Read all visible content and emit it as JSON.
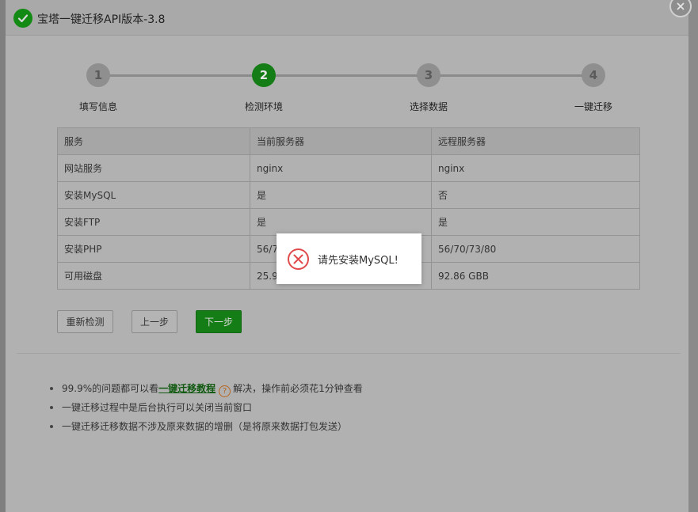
{
  "modal": {
    "title": "宝塔一键迁移API版本-3.8"
  },
  "steps": [
    {
      "number": "1",
      "label": "填写信息"
    },
    {
      "number": "2",
      "label": "检测环境"
    },
    {
      "number": "3",
      "label": "选择数据"
    },
    {
      "number": "4",
      "label": "一键迁移"
    }
  ],
  "table": {
    "headers": [
      "服务",
      "当前服务器",
      "远程服务器"
    ],
    "rows": [
      [
        "网站服务",
        "nginx",
        "nginx"
      ],
      [
        "安装MySQL",
        "是",
        "否"
      ],
      [
        "安装FTP",
        "是",
        "是"
      ],
      [
        "安装PHP",
        "56/7",
        "56/70/73/80"
      ],
      [
        "可用磁盘",
        "25.9",
        "92.86 GBB"
      ]
    ]
  },
  "buttons": {
    "recheck": "重新检测",
    "prev": "上一步",
    "next": "下一步"
  },
  "notes": {
    "line1_prefix": "99.9%的问题都可以看",
    "line1_link": "一键迁移教程",
    "line1_suffix": "解决，操作前必须花1分钟查看",
    "line2": "一键迁移过程中是后台执行可以关闭当前窗口",
    "line3": "一键迁移迁移数据不涉及原来数据的增删（是将原来数据打包发送）"
  },
  "toast": {
    "message": "请先安装MySQL!"
  },
  "colors": {
    "accent_green": "#20a53a",
    "error_red": "#e14a4a"
  }
}
